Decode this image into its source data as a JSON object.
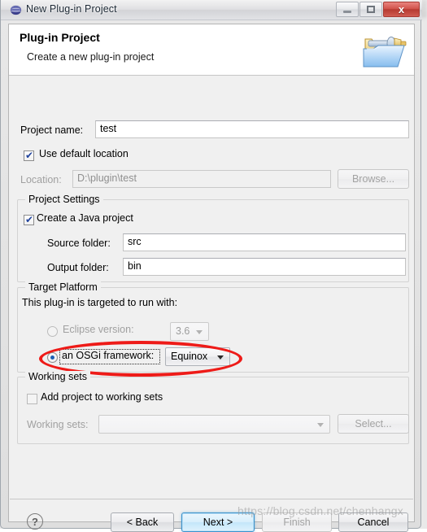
{
  "window": {
    "title": "New Plug-in Project",
    "app_icon": "eclipse-icon",
    "controls": {
      "minimize": "minimize-icon",
      "maximize": "restore-icon",
      "close": "x"
    }
  },
  "banner": {
    "title": "Plug-in Project",
    "subtitle": "Create a new plug-in project",
    "icon": "plugin-project-folder-icon"
  },
  "project": {
    "name_label": "Project name:",
    "name_value": "test",
    "use_default_location_label": "Use default location",
    "use_default_location_checked": true,
    "location_label": "Location:",
    "location_value": "D:\\plugin\\test",
    "browse_label": "Browse..."
  },
  "project_settings": {
    "group_title": "Project Settings",
    "create_java_label": "Create a Java project",
    "create_java_checked": true,
    "source_folder_label": "Source folder:",
    "source_folder_value": "src",
    "output_folder_label": "Output folder:",
    "output_folder_value": "bin"
  },
  "target_platform": {
    "group_title": "Target Platform",
    "description": "This plug-in is targeted to run with:",
    "eclipse_version_label": "Eclipse version:",
    "eclipse_version_selected": false,
    "eclipse_version_value": "3.6",
    "osgi_label": "an OSGi framework:",
    "osgi_selected": true,
    "osgi_value": "Equinox"
  },
  "working_sets": {
    "group_title": "Working sets",
    "add_project_label": "Add project to working sets",
    "add_project_checked": false,
    "working_sets_label": "Working sets:",
    "working_sets_value": "",
    "select_label": "Select..."
  },
  "buttons": {
    "help": "?",
    "back": "< Back",
    "next": "Next >",
    "finish": "Finish",
    "cancel": "Cancel"
  },
  "watermark": "https://blog.csdn.net/chenhangx",
  "colors": {
    "accent_blue": "#3c93cd",
    "annotation_red": "#ee1b18",
    "dialog_bg": "#f0f0f0",
    "banner_bg": "#ffffff",
    "close_red": "#b63a31"
  }
}
